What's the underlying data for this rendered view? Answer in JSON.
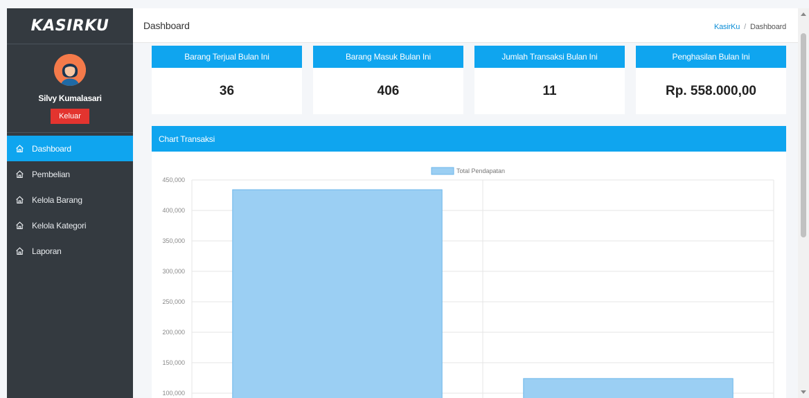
{
  "brand": "KASIRKU",
  "user": {
    "name": "Silvy Kumalasari",
    "logout_label": "Keluar"
  },
  "nav": [
    {
      "label": "Dashboard",
      "icon": "home-icon",
      "active": true
    },
    {
      "label": "Pembelian",
      "icon": "home-icon"
    },
    {
      "label": "Kelola Barang",
      "icon": "home-icon"
    },
    {
      "label": "Kelola Kategori",
      "icon": "home-icon"
    },
    {
      "label": "Laporan",
      "icon": "home-icon"
    }
  ],
  "header": {
    "title": "Dashboard",
    "breadcrumb": [
      "KasirKu",
      "Dashboard"
    ],
    "breadcrumb_sep": "/"
  },
  "stats": [
    {
      "label": "Barang Terjual Bulan Ini",
      "value": "36"
    },
    {
      "label": "Barang Masuk Bulan Ini",
      "value": "406"
    },
    {
      "label": "Jumlah Transaksi Bulan Ini",
      "value": "11"
    },
    {
      "label": "Penghasilan Bulan Ini",
      "value": "Rp. 558.000,00"
    }
  ],
  "chart_panel": {
    "title": "Chart Transaksi"
  },
  "chart_data": {
    "type": "bar",
    "categories": [
      "",
      ""
    ],
    "series": [
      {
        "name": "Total Pendapatan",
        "values": [
          434000,
          124000
        ]
      }
    ],
    "ylim": [
      100000,
      450000
    ],
    "yticks": [
      "100,000",
      "150,000",
      "200,000",
      "250,000",
      "300,000",
      "350,000",
      "400,000",
      "450,000"
    ],
    "ytick_values": [
      100000,
      150000,
      200000,
      250000,
      300000,
      350000,
      400000,
      450000
    ],
    "grid": true,
    "legend": "top-center"
  },
  "colors": {
    "accent": "#0fa5ef",
    "sidebar": "#343a40",
    "danger": "#e3342f",
    "bar_fill": "#9bcff3",
    "bar_stroke": "#6cb6ea"
  }
}
